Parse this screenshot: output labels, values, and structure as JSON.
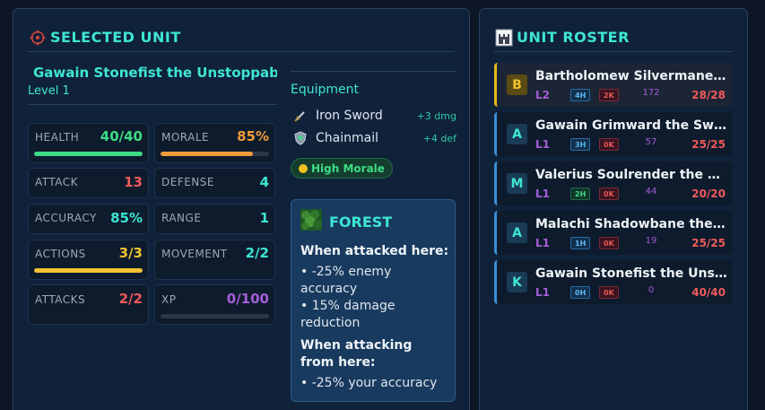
{
  "selected": {
    "title": "SELECTED UNIT",
    "name": "Gawain Stonefist the Unstoppable",
    "level": "Level 1",
    "stats": [
      {
        "label": "HEALTH",
        "value": "40/40",
        "color": "#3ddc84",
        "bar": 1.0
      },
      {
        "label": "MORALE",
        "value": "85%",
        "color": "#f09a3a",
        "bar": 0.85
      },
      {
        "label": "ATTACK",
        "value": "13",
        "color": "#ef5a5a"
      },
      {
        "label": "DEFENSE",
        "value": "4",
        "color": "#3ee6d2"
      },
      {
        "label": "ACCURACY",
        "value": "85%",
        "color": "#3ee6d2"
      },
      {
        "label": "RANGE",
        "value": "1",
        "color": "#3ee6d2"
      },
      {
        "label": "ACTIONS",
        "value": "3/3",
        "color": "#f2c230",
        "bar": 1.0
      },
      {
        "label": "MOVEMENT",
        "value": "2/2",
        "color": "#3ee6d2"
      },
      {
        "label": "ATTACKS",
        "value": "2/2",
        "color": "#ef5a5a"
      },
      {
        "label": "XP",
        "value": "0/100",
        "color": "#a55ed8",
        "bar": 0.0
      }
    ],
    "equipment": {
      "title": "Equipment",
      "items": [
        {
          "name": "Iron Sword",
          "bonus": "+3 dmg",
          "icon": "sword-icon"
        },
        {
          "name": "Chainmail",
          "bonus": "+4 def",
          "icon": "shield-icon"
        }
      ]
    },
    "morale_badge": "High Morale",
    "terrain": {
      "name": "FOREST",
      "when_attacked_title": "When attacked here:",
      "when_attacked": [
        "• -25% enemy accuracy",
        "• 15% damage reduction"
      ],
      "when_attacking_title": "When attacking from here:",
      "when_attacking": [
        "• -25% your accuracy"
      ]
    }
  },
  "roster": {
    "title": "UNIT ROSTER",
    "units": [
      {
        "badge": "B",
        "name": "Bartholomew Silvermane the Brave",
        "level": "L2",
        "h": "4H",
        "k": "2K",
        "xp": "172",
        "hp": "28/28",
        "selected": true,
        "h_green": false
      },
      {
        "badge": "A",
        "name": "Gawain Grimward the Swift",
        "level": "L1",
        "h": "3H",
        "k": "0K",
        "xp": "57",
        "hp": "25/25",
        "selected": false,
        "h_green": false
      },
      {
        "badge": "M",
        "name": "Valerius Soulrender the Mystic",
        "level": "L1",
        "h": "2H",
        "k": "0K",
        "xp": "44",
        "hp": "20/20",
        "selected": false,
        "h_green": true
      },
      {
        "badge": "A",
        "name": "Malachi Shadowbane the Keen",
        "level": "L1",
        "h": "1H",
        "k": "0K",
        "xp": "19",
        "hp": "25/25",
        "selected": false,
        "h_green": false
      },
      {
        "badge": "K",
        "name": "Gawain Stonefist the Unstoppable",
        "level": "L1",
        "h": "0H",
        "k": "0K",
        "xp": "0",
        "hp": "40/40",
        "selected": false,
        "h_green": false
      }
    ]
  }
}
